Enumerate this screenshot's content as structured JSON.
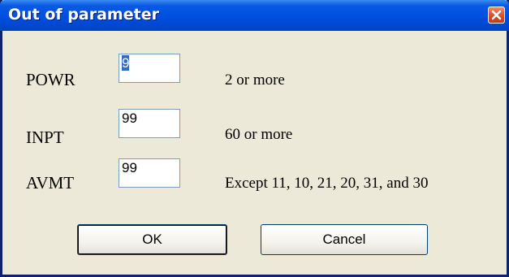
{
  "window": {
    "title": "Out of parameter",
    "close_icon": "close-icon"
  },
  "params": [
    {
      "label": "POWR",
      "value": "9",
      "hint": "2 or more"
    },
    {
      "label": "INPT",
      "value": "99",
      "hint": "60 or more"
    },
    {
      "label": "AVMT",
      "value": "99",
      "hint": "Except 11, 10, 21, 20, 31, and 30"
    }
  ],
  "buttons": {
    "ok_label": "OK",
    "cancel_label": "Cancel"
  },
  "colors": {
    "titlebar": "#0050e0",
    "dialog_bg": "#ece9d8",
    "close_button": "#e0502a",
    "selection": "#316ac5"
  }
}
